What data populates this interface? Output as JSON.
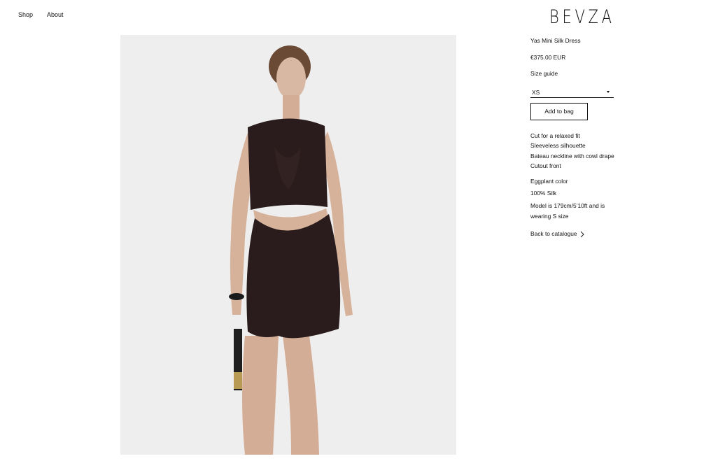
{
  "nav": {
    "shop": "Shop",
    "about": "About"
  },
  "brand": "BEVZA",
  "product": {
    "title": "Yas Mini Silk Dress",
    "price": "€375.00 EUR",
    "size_guide": "Size guide",
    "size_selected": "XS",
    "add_to_bag": "Add to bag",
    "description": [
      "Cut for a relaxed fit",
      "Sleeveless silhouette",
      "Bateau neckline with cowl drape",
      "Cutout front"
    ],
    "specs": [
      "Eggplant color",
      "100% Silk",
      "Model is 179cm/5’10ft and is wearing S size"
    ],
    "back_link": "Back to catalogue"
  },
  "icons": {
    "select": "chevron-down-icon",
    "back": "chevron-right-icon"
  },
  "colors": {
    "background": "#ffffff",
    "photo_bg": "#eeeeee",
    "dress": "#2a1c1c",
    "text": "#111111"
  }
}
